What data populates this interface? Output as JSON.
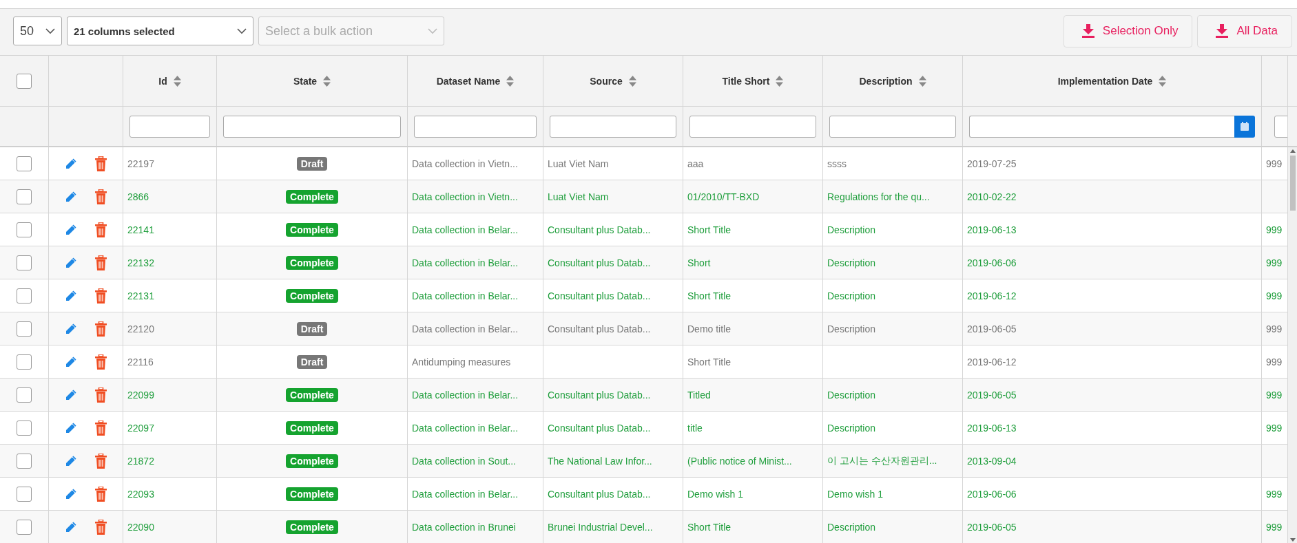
{
  "toolbar": {
    "page_size": "50",
    "columns_select": "21 columns selected",
    "bulk_action": {
      "placeholder": "Select a bulk action",
      "disabled": true
    },
    "buttons": [
      "Selection Only",
      "All Data"
    ]
  },
  "table": {
    "select_all": {
      "checked": false
    },
    "columns": [
      {
        "label": "Id",
        "kind": "text"
      },
      {
        "label": "State",
        "kind": "text"
      },
      {
        "label": "Dataset Name",
        "kind": "text"
      },
      {
        "label": "Source",
        "kind": "text"
      },
      {
        "label": "Title Short",
        "kind": "text"
      },
      {
        "label": "Description",
        "kind": "text"
      },
      {
        "label": "Implementation Date",
        "kind": "date"
      },
      {
        "kind": "text"
      }
    ],
    "rows": [
      {
        "checked": false,
        "kind": "draft",
        "id": "22197",
        "state": "Draft",
        "dataset_name": "Data collection in Vietn...",
        "source": "Luat Viet Nam",
        "title_short": "aaa",
        "description": "ssss",
        "implementation_date": "2019-07-25",
        "column_9": "999"
      },
      {
        "checked": false,
        "kind": "complete",
        "id": "2866",
        "state": "Complete",
        "dataset_name": "Data collection in Vietn...",
        "source": "Luat Viet Nam",
        "title_short": "01/2010/TT-BXD",
        "description": "Regulations for the qu...",
        "implementation_date": "2010-02-22"
      },
      {
        "checked": false,
        "kind": "complete",
        "id": "22141",
        "state": "Complete",
        "dataset_name": "Data collection in Belar...",
        "source": "Consultant plus Datab...",
        "title_short": "Short Title",
        "description": "Description",
        "implementation_date": "2019-06-13",
        "column_9": "999"
      },
      {
        "checked": false,
        "kind": "complete",
        "id": "22132",
        "state": "Complete",
        "dataset_name": "Data collection in Belar...",
        "source": "Consultant plus Datab...",
        "title_short": "Short",
        "description": "Description",
        "implementation_date": "2019-06-06",
        "column_9": "999"
      },
      {
        "checked": false,
        "kind": "complete",
        "id": "22131",
        "state": "Complete",
        "dataset_name": "Data collection in Belar...",
        "source": "Consultant plus Datab...",
        "title_short": "Short Title",
        "description": "Description",
        "implementation_date": "2019-06-12",
        "column_9": "999"
      },
      {
        "checked": false,
        "kind": "draft",
        "id": "22120",
        "state": "Draft",
        "dataset_name": "Data collection in Belar...",
        "source": "Consultant plus Datab...",
        "title_short": "Demo title",
        "description": "Description",
        "implementation_date": "2019-06-05",
        "column_9": "999"
      },
      {
        "checked": false,
        "kind": "draft",
        "id": "22116",
        "state": "Draft",
        "dataset_name": "Antidumping measures",
        "title_short": "Short Title",
        "implementation_date": "2019-06-12",
        "column_9": "999"
      },
      {
        "checked": false,
        "kind": "complete",
        "id": "22099",
        "state": "Complete",
        "dataset_name": "Data collection in Belar...",
        "source": "Consultant plus Datab...",
        "title_short": "Titled",
        "description": "Description",
        "implementation_date": "2019-06-05",
        "column_9": "999"
      },
      {
        "checked": false,
        "kind": "complete",
        "id": "22097",
        "state": "Complete",
        "dataset_name": "Data collection in Belar...",
        "source": "Consultant plus Datab...",
        "title_short": "title",
        "description": "Description",
        "implementation_date": "2019-06-13",
        "column_9": "999"
      },
      {
        "checked": false,
        "kind": "complete",
        "id": "21872",
        "state": "Complete",
        "dataset_name": "Data collection in Sout...",
        "source": "The National Law Infor...",
        "title_short": "(Public notice of Minist...",
        "description": "이 고시는 수산자원관리...",
        "implementation_date": "2013-09-04"
      },
      {
        "checked": false,
        "kind": "complete",
        "id": "22093",
        "state": "Complete",
        "dataset_name": "Data collection in Belar...",
        "source": "Consultant plus Datab...",
        "title_short": "Demo wish 1",
        "description": "Demo wish 1",
        "implementation_date": "2019-06-06",
        "column_9": "999"
      },
      {
        "checked": false,
        "kind": "complete",
        "id": "22090",
        "state": "Complete",
        "dataset_name": "Data collection in Brunei",
        "source": "Brunei Industrial Devel...",
        "title_short": "Short Title",
        "description": "Description",
        "implementation_date": "2019-06-05",
        "column_9": "999"
      }
    ]
  }
}
